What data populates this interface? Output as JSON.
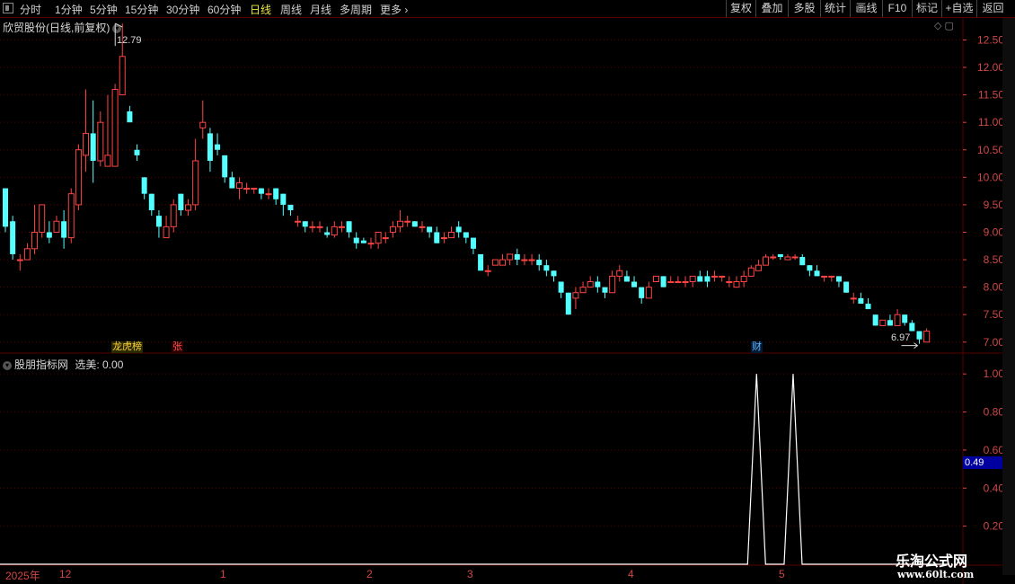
{
  "toolbar": {
    "periods": [
      "分时",
      "1分钟",
      "5分钟",
      "15分钟",
      "30分钟",
      "60分钟",
      "日线",
      "周线",
      "月线",
      "多周期",
      "更多"
    ],
    "active_period": "日线",
    "right_buttons": [
      "复权",
      "叠加",
      "多股",
      "统计",
      "画线",
      "F10",
      "标记",
      "+自选",
      "返回"
    ]
  },
  "main_panel": {
    "title": "欣贸股份(日线,前复权)",
    "max_label": "12.79",
    "min_label": "6.97",
    "y_ticks": [
      "12.50",
      "12.00",
      "11.50",
      "11.00",
      "10.50",
      "10.00",
      "9.50",
      "9.00",
      "8.50",
      "8.00",
      "7.50",
      "7.00"
    ],
    "badges": [
      {
        "text": "龙虎榜",
        "color": "#e8c020"
      },
      {
        "text": "张",
        "color": "#e04040"
      },
      {
        "text": "财",
        "color": "#4aa0ff"
      }
    ]
  },
  "indicator_panel": {
    "title": "股朋指标网",
    "series_label": "选美:",
    "series_value": "0.00",
    "y_ticks": [
      "1.00",
      "0.80",
      "0.60",
      "0.40",
      "0.20"
    ],
    "cursor_value": "0.49"
  },
  "time_axis": {
    "labels": [
      "2025年",
      "12",
      "1",
      "2",
      "3",
      "4",
      "5"
    ]
  },
  "watermark": {
    "line1": "乐淘公式网",
    "line2": "www.60lt.com"
  },
  "colors": {
    "up": "#ff4444",
    "down": "#54ffff",
    "grid": "#5a0000",
    "line": "#ffffff"
  },
  "chart_data": [
    {
      "type": "candlestick",
      "title": "欣贸股份(日线,前复权)",
      "ylim": [
        6.8,
        12.9
      ],
      "series": [
        {
          "values": [
            [
              9.8,
              9.1,
              9.8,
              9.0
            ],
            [
              9.2,
              8.6,
              9.3,
              8.5
            ],
            [
              8.5,
              8.5,
              8.6,
              8.3
            ],
            [
              8.5,
              8.7,
              8.8,
              8.5
            ],
            [
              8.7,
              9.0,
              9.5,
              8.6
            ],
            [
              9.0,
              9.5,
              9.5,
              8.9
            ],
            [
              9.0,
              8.9,
              9.2,
              8.8
            ],
            [
              9.0,
              9.2,
              9.3,
              9.0
            ],
            [
              9.2,
              8.9,
              9.4,
              8.7
            ],
            [
              8.9,
              9.7,
              9.8,
              8.8
            ],
            [
              9.5,
              10.5,
              10.6,
              9.4
            ],
            [
              10.4,
              10.8,
              11.6,
              10.1
            ],
            [
              10.8,
              10.3,
              11.4,
              9.9
            ],
            [
              10.3,
              11.0,
              11.2,
              10.2
            ],
            [
              10.2,
              10.4,
              11.5,
              10.2
            ],
            [
              10.2,
              11.6,
              11.7,
              10.2
            ],
            [
              11.5,
              12.2,
              12.8,
              11.5
            ],
            [
              11.2,
              11.0,
              11.3,
              11.1
            ],
            [
              10.5,
              10.4,
              10.6,
              10.3
            ],
            [
              10.0,
              9.7,
              10.0,
              9.6
            ],
            [
              9.7,
              9.4,
              9.7,
              9.3
            ],
            [
              9.3,
              9.1,
              9.4,
              8.9
            ],
            [
              8.9,
              9.1,
              9.3,
              8.9
            ],
            [
              9.1,
              9.5,
              9.6,
              9.0
            ],
            [
              9.7,
              9.4,
              9.7,
              9.3
            ],
            [
              9.4,
              9.5,
              9.6,
              9.3
            ],
            [
              9.5,
              10.3,
              10.7,
              9.4
            ],
            [
              10.9,
              11.0,
              11.4,
              10.7
            ],
            [
              10.8,
              10.3,
              10.9,
              10.1
            ],
            [
              10.6,
              10.5,
              10.8,
              10.4
            ],
            [
              10.4,
              10.0,
              10.4,
              9.9
            ],
            [
              10.0,
              9.8,
              10.1,
              9.8
            ],
            [
              9.8,
              9.9,
              10.0,
              9.6
            ],
            [
              9.8,
              9.8,
              9.9,
              9.7
            ],
            [
              9.8,
              9.8,
              9.8,
              9.7
            ],
            [
              9.8,
              9.7,
              9.8,
              9.6
            ],
            [
              9.7,
              9.7,
              9.8,
              9.6
            ],
            [
              9.8,
              9.6,
              9.8,
              9.5
            ],
            [
              9.7,
              9.5,
              9.7,
              9.3
            ],
            [
              9.5,
              9.4,
              9.5,
              9.3
            ],
            [
              9.2,
              9.2,
              9.3,
              9.1
            ],
            [
              9.2,
              9.1,
              9.2,
              9.0
            ],
            [
              9.1,
              9.1,
              9.2,
              9.0
            ],
            [
              9.1,
              9.1,
              9.2,
              9.0
            ],
            [
              9.0,
              8.95,
              9.1,
              8.9
            ],
            [
              8.95,
              9.1,
              9.2,
              8.9
            ],
            [
              9.1,
              9.1,
              9.2,
              9.0
            ],
            [
              9.2,
              9.0,
              9.2,
              8.9
            ],
            [
              8.9,
              8.8,
              9.0,
              8.7
            ],
            [
              8.85,
              8.8,
              8.9,
              8.8
            ],
            [
              8.8,
              8.8,
              8.9,
              8.7
            ],
            [
              8.8,
              9.0,
              9.0,
              8.7
            ],
            [
              8.9,
              8.9,
              9.0,
              8.8
            ],
            [
              9.0,
              9.1,
              9.2,
              8.9
            ],
            [
              9.1,
              9.2,
              9.4,
              9.0
            ],
            [
              9.2,
              9.2,
              9.3,
              9.1
            ],
            [
              9.2,
              9.1,
              9.2,
              9.1
            ],
            [
              9.1,
              9.1,
              9.2,
              9.0
            ],
            [
              9.1,
              9.0,
              9.1,
              8.9
            ],
            [
              9.0,
              8.8,
              9.1,
              8.8
            ],
            [
              8.9,
              8.9,
              9.0,
              8.8
            ],
            [
              8.9,
              9.0,
              9.1,
              8.9
            ],
            [
              9.1,
              9.0,
              9.2,
              8.9
            ],
            [
              9.0,
              8.9,
              9.0,
              8.8
            ],
            [
              8.9,
              8.7,
              8.9,
              8.6
            ],
            [
              8.6,
              8.3,
              8.6,
              8.3
            ],
            [
              8.3,
              8.3,
              8.4,
              8.2
            ],
            [
              8.4,
              8.5,
              8.5,
              8.4
            ],
            [
              8.4,
              8.5,
              8.6,
              8.4
            ],
            [
              8.5,
              8.6,
              8.6,
              8.4
            ],
            [
              8.6,
              8.5,
              8.7,
              8.4
            ],
            [
              8.5,
              8.5,
              8.6,
              8.4
            ],
            [
              8.5,
              8.5,
              8.6,
              8.4
            ],
            [
              8.5,
              8.4,
              8.6,
              8.3
            ],
            [
              8.4,
              8.3,
              8.5,
              8.2
            ],
            [
              8.3,
              8.2,
              8.3,
              8.1
            ],
            [
              8.1,
              7.9,
              8.1,
              7.8
            ],
            [
              7.9,
              7.5,
              7.9,
              7.5
            ],
            [
              7.8,
              7.9,
              8.0,
              7.6
            ],
            [
              7.9,
              8.0,
              8.1,
              7.9
            ],
            [
              8.0,
              8.1,
              8.2,
              8.0
            ],
            [
              8.1,
              8.0,
              8.2,
              7.9
            ],
            [
              8.0,
              7.9,
              8.0,
              7.8
            ],
            [
              7.9,
              8.2,
              8.3,
              7.9
            ],
            [
              8.2,
              8.3,
              8.4,
              8.1
            ],
            [
              8.2,
              8.1,
              8.3,
              8.1
            ],
            [
              8.1,
              8.0,
              8.2,
              8.0
            ],
            [
              8.0,
              7.8,
              8.0,
              7.7
            ],
            [
              7.8,
              8.0,
              8.1,
              7.8
            ],
            [
              8.1,
              8.2,
              8.2,
              8.1
            ],
            [
              8.2,
              8.0,
              8.2,
              8.0
            ],
            [
              8.1,
              8.1,
              8.2,
              8.1
            ],
            [
              8.1,
              8.1,
              8.2,
              8.1
            ],
            [
              8.1,
              8.1,
              8.2,
              8.0
            ],
            [
              8.1,
              8.2,
              8.2,
              8.0
            ],
            [
              8.2,
              8.1,
              8.3,
              8.1
            ],
            [
              8.2,
              8.1,
              8.3,
              8.0
            ],
            [
              8.2,
              8.2,
              8.3,
              8.1
            ],
            [
              8.2,
              8.2,
              8.2,
              8.1
            ],
            [
              8.1,
              8.1,
              8.2,
              8.0
            ],
            [
              8.0,
              8.1,
              8.2,
              8.0
            ],
            [
              8.1,
              8.2,
              8.3,
              8.0
            ],
            [
              8.2,
              8.35,
              8.4,
              8.2
            ],
            [
              8.3,
              8.4,
              8.5,
              8.3
            ],
            [
              8.4,
              8.55,
              8.6,
              8.4
            ],
            [
              8.55,
              8.55,
              8.6,
              8.5
            ],
            [
              8.6,
              8.55,
              8.6,
              8.5
            ],
            [
              8.5,
              8.55,
              8.6,
              8.5
            ],
            [
              8.55,
              8.55,
              8.6,
              8.5
            ],
            [
              8.55,
              8.4,
              8.6,
              8.4
            ],
            [
              8.4,
              8.3,
              8.4,
              8.2
            ],
            [
              8.3,
              8.2,
              8.4,
              8.2
            ],
            [
              8.2,
              8.2,
              8.2,
              8.1
            ],
            [
              8.2,
              8.2,
              8.2,
              8.1
            ],
            [
              8.2,
              8.1,
              8.2,
              8.0
            ],
            [
              8.1,
              7.9,
              8.1,
              7.9
            ],
            [
              7.8,
              7.8,
              7.9,
              7.7
            ],
            [
              7.8,
              7.7,
              7.9,
              7.7
            ],
            [
              7.7,
              7.6,
              7.8,
              7.6
            ],
            [
              7.5,
              7.3,
              7.5,
              7.3
            ],
            [
              7.3,
              7.4,
              7.4,
              7.3
            ],
            [
              7.4,
              7.3,
              7.5,
              7.3
            ],
            [
              7.3,
              7.5,
              7.6,
              7.3
            ],
            [
              7.5,
              7.35,
              7.5,
              7.3
            ],
            [
              7.35,
              7.2,
              7.4,
              7.2
            ],
            [
              7.2,
              7.05,
              7.2,
              6.97
            ],
            [
              7.0,
              7.2,
              7.25,
              7.0
            ]
          ]
        }
      ]
    },
    {
      "type": "line",
      "title": "股朋指标网",
      "ylim": [
        0,
        1.1
      ],
      "series": [
        {
          "name": "选美",
          "spikes": [
            102,
            107
          ]
        }
      ]
    }
  ]
}
